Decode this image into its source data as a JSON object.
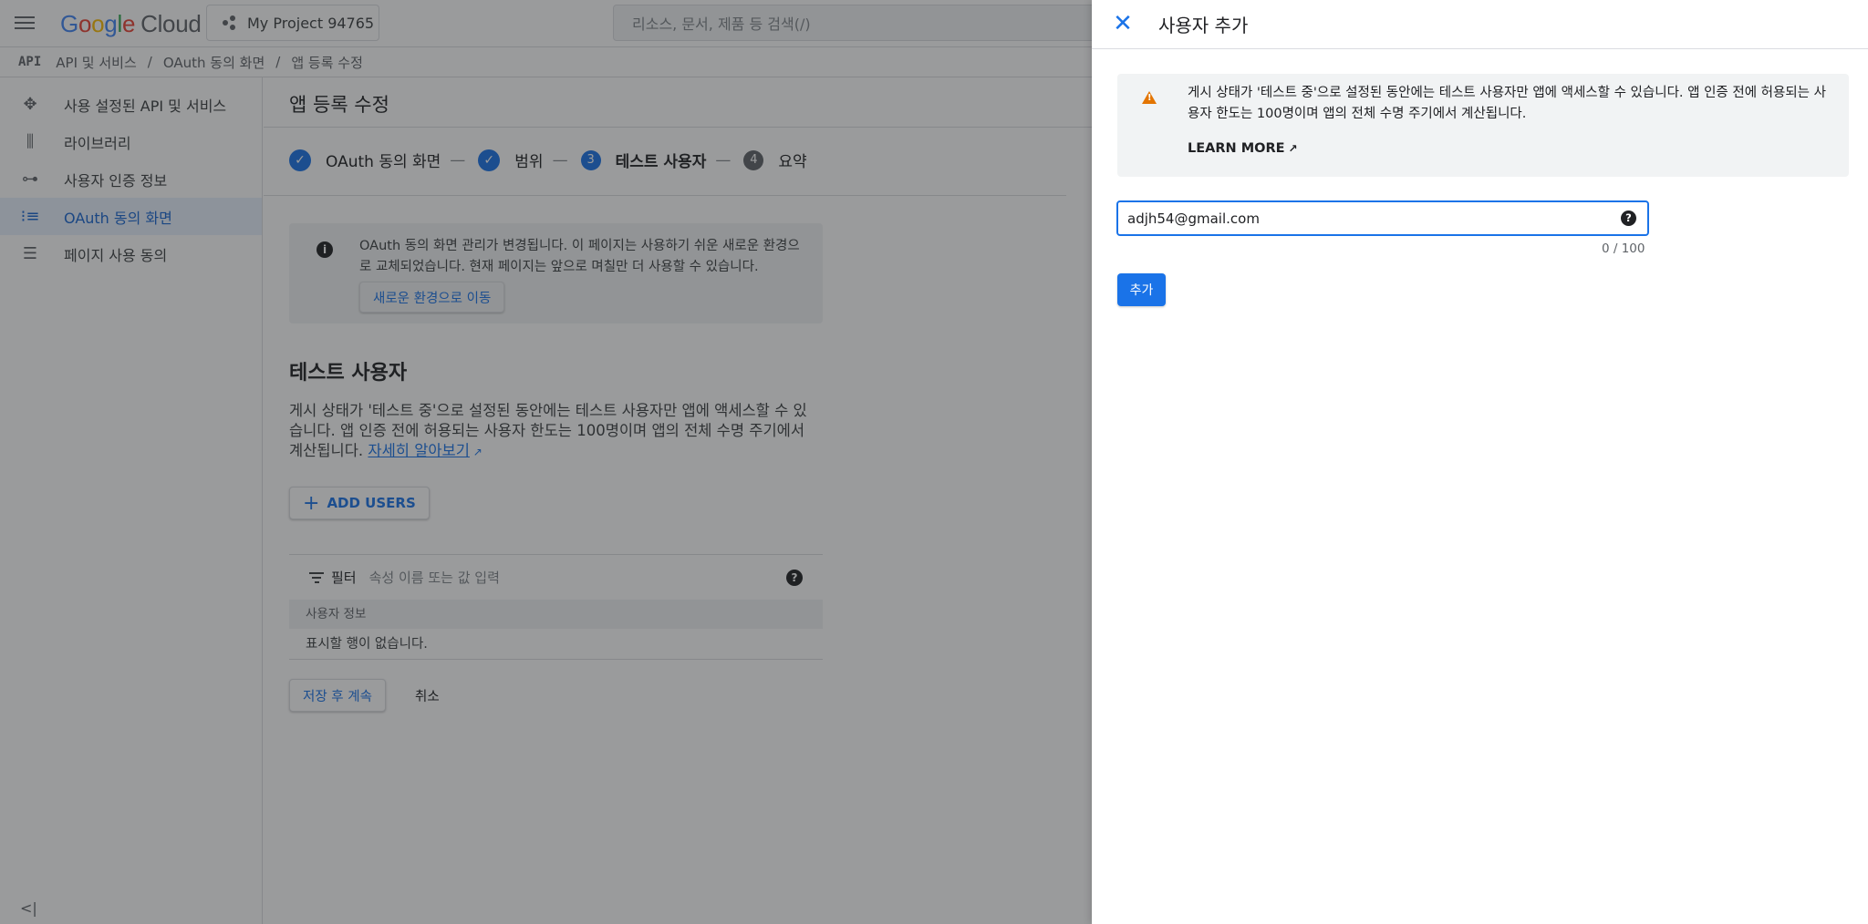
{
  "topbar": {
    "logo_google": "Google",
    "logo_cloud": "Cloud",
    "project": "My Project 94765",
    "search_placeholder": "리소스, 문서, 제품 등 검색(/)"
  },
  "breadcrumb": {
    "api_badge": "API",
    "items": [
      "API 및 서비스",
      "OAuth 동의 화면",
      "앱 등록 수정"
    ],
    "separator": "/"
  },
  "sidebar": {
    "items": [
      {
        "label": "사용 설정된 API 및 서비스",
        "icon": "api-icon"
      },
      {
        "label": "라이브러리",
        "icon": "library-icon"
      },
      {
        "label": "사용자 인증 정보",
        "icon": "key-icon"
      },
      {
        "label": "OAuth 동의 화면",
        "icon": "consent-icon",
        "active": true
      },
      {
        "label": "페이지 사용 동의",
        "icon": "settings-list-icon"
      }
    ],
    "collapse_label": "<|"
  },
  "main": {
    "title": "앱 등록 수정",
    "steps": [
      {
        "label": "OAuth 동의 화면",
        "state": "done"
      },
      {
        "label": "범위",
        "state": "done"
      },
      {
        "num": "3",
        "label": "테스트 사용자",
        "state": "current"
      },
      {
        "num": "4",
        "label": "요약",
        "state": "pending"
      }
    ],
    "step_dash": "—",
    "info_text": "OAuth 동의 화면 관리가 변경됩니다. 이 페이지는 사용하기 쉬운 새로운 환경으로 교체되었습니다. 현재 페이지는 앞으로 며칠만 더 사용할 수 있습니다.",
    "info_button": "새로운 환경으로 이동",
    "section_title": "테스트 사용자",
    "section_desc": "게시 상태가 '테스트 중'으로 설정된 동안에는 테스트 사용자만 앱에 액세스할 수 있습니다. 앱 인증 전에 허용되는 사용자 한도는 100명이며 앱의 전체 수명 주기에서 계산됩니다.",
    "learn_more_link": "자세히 알아보기",
    "add_users_button": "ADD USERS",
    "filter_label": "필터",
    "filter_placeholder": "속성 이름 또는 값 입력",
    "table_header": "사용자 정보",
    "table_empty": "표시할 행이 없습니다.",
    "save_button": "저장 후 계속",
    "cancel_button": "취소"
  },
  "panel": {
    "title": "사용자 추가",
    "warning_text": "게시 상태가 '테스트 중'으로 설정된 동안에는 테스트 사용자만 앱에 액세스할 수 있습니다. 앱 인증 전에 허용되는 사용자 한도는 100명이며 앱의 전체 수명 주기에서 계산됩니다.",
    "learn_more": "LEARN MORE",
    "email_value": "adjh54@gmail.com",
    "char_count": "0 / 100",
    "add_button": "추가"
  },
  "colors": {
    "accent": "#1a73e8",
    "warning": "#e37400"
  }
}
